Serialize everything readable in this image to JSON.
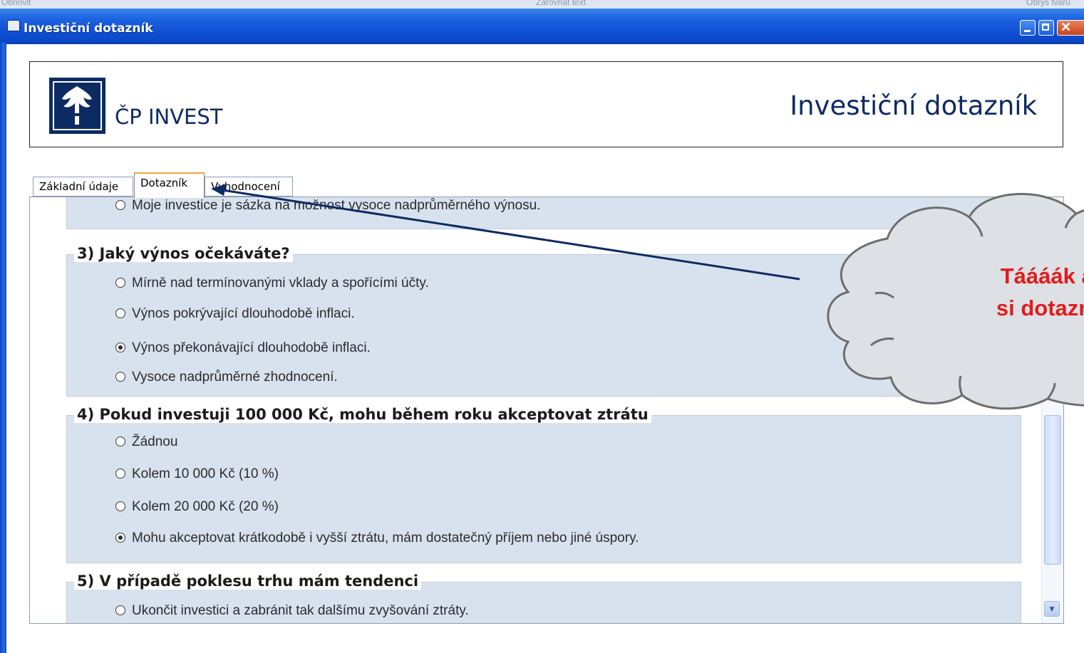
{
  "window": {
    "title": "Investiční dotazník"
  },
  "header": {
    "brand": "ČP INVEST",
    "title": "Investiční dotazník"
  },
  "tabs": [
    {
      "label": "Základní údaje",
      "active": false
    },
    {
      "label": "Dotazník",
      "active": true
    },
    {
      "label": "Vyhodnocení",
      "active": false
    }
  ],
  "questionnaire": {
    "prev_option": "Moje investice je sázka na možnost vysoce nadprůměrného výnosu.",
    "q3": {
      "label": "3) Jaký výnos očekáváte?",
      "options": [
        {
          "text": "Mírně nad termínovanými vklady a spořícími účty.",
          "selected": false
        },
        {
          "text": "Výnos pokrývající dlouhodobě inflaci.",
          "selected": false
        },
        {
          "text": "Výnos překonávající dlouhodobě inflaci.",
          "selected": true
        },
        {
          "text": "Vysoce nadprůměrné zhodnocení.",
          "selected": false
        }
      ]
    },
    "q4": {
      "label": "4) Pokud investuji 100 000 Kč, mohu během roku akceptovat ztrátu",
      "options": [
        {
          "text": "Žádnou",
          "selected": false
        },
        {
          "text": "Kolem 10 000 Kč (10 %)",
          "selected": false
        },
        {
          "text": "Kolem 20 000 Kč (20 %)",
          "selected": false
        },
        {
          "text": "Mohu akceptovat krátkodobě i vyšší ztrátu, mám dostatečný příjem nebo jiné úspory.",
          "selected": true
        }
      ]
    },
    "q5": {
      "label": "5) V případě poklesu trhu mám tendenci",
      "options": [
        {
          "text": "Ukončit investici a zabránit tak dalšímu zvyšování ztráty.",
          "selected": false
        }
      ]
    }
  },
  "callout": {
    "line1": "Táááák a d",
    "line2": "si dotazník",
    "color": "#e31b1b"
  },
  "background_app": {
    "text_left": "Obnovit",
    "text_mid": "Zarovnat text",
    "text_right": "Obrys tvaru"
  }
}
